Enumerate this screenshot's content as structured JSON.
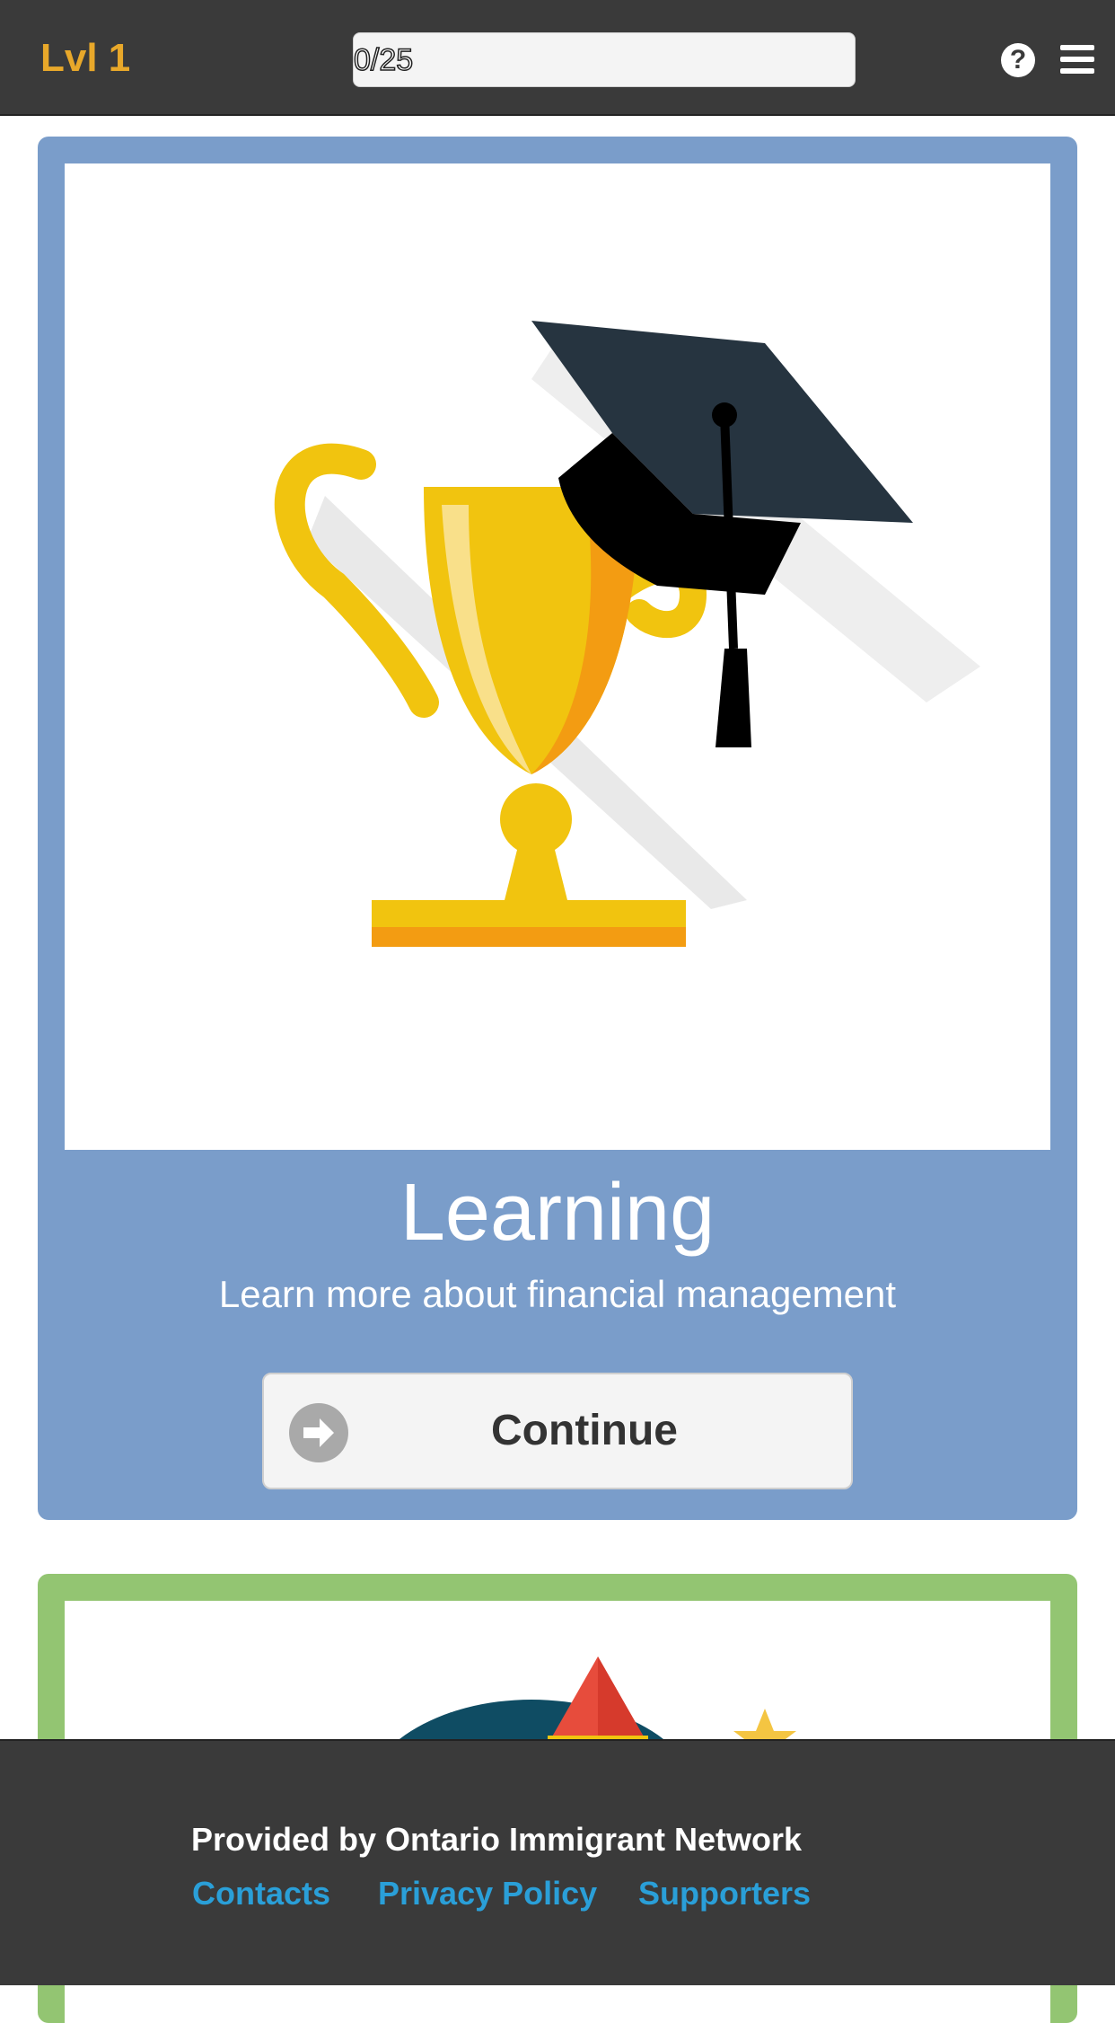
{
  "header": {
    "level": "Lvl 1",
    "progress_text": "0/25",
    "progress_fraction": 0,
    "help_icon": "question-circle-icon",
    "menu_icon": "hamburger-menu-icon"
  },
  "cards": [
    {
      "title": "Learning",
      "subtitle": "Learn more about financial management",
      "button_label": "Continue",
      "button_icon": "arrow-right-circle-icon",
      "image": "trophy-graduation-cap-illustration",
      "color": "#7a9dca"
    },
    {
      "image": "rocket-planet-illustration",
      "color": "#93c572"
    }
  ],
  "footer": {
    "provider": "Provided by Ontario Immigrant Network",
    "links": [
      "Contacts",
      "Privacy Policy",
      "Supporters"
    ],
    "link_color": "#2a9fd8"
  },
  "colors": {
    "header_bg": "#3a3a3a",
    "level_color": "#e8a82a"
  }
}
